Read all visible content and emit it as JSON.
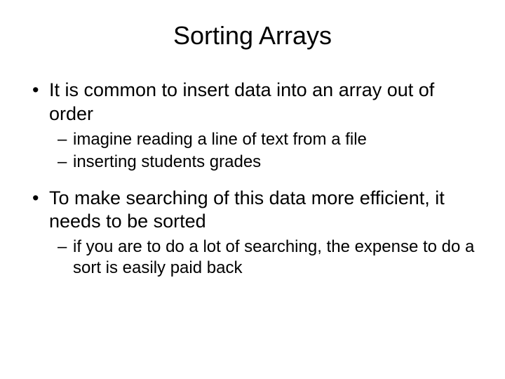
{
  "title": "Sorting Arrays",
  "bullets": {
    "b1": "It is common to insert data into an array out of order",
    "b1_1": "imagine reading a line of  text from a file",
    "b1_2": "inserting students grades",
    "b2": "To make searching of this data more efficient, it needs to be sorted",
    "b2_1": "if you are to do a lot of searching, the expense to do a sort is easily paid back"
  },
  "markers": {
    "disc": "•",
    "dash": "–"
  }
}
